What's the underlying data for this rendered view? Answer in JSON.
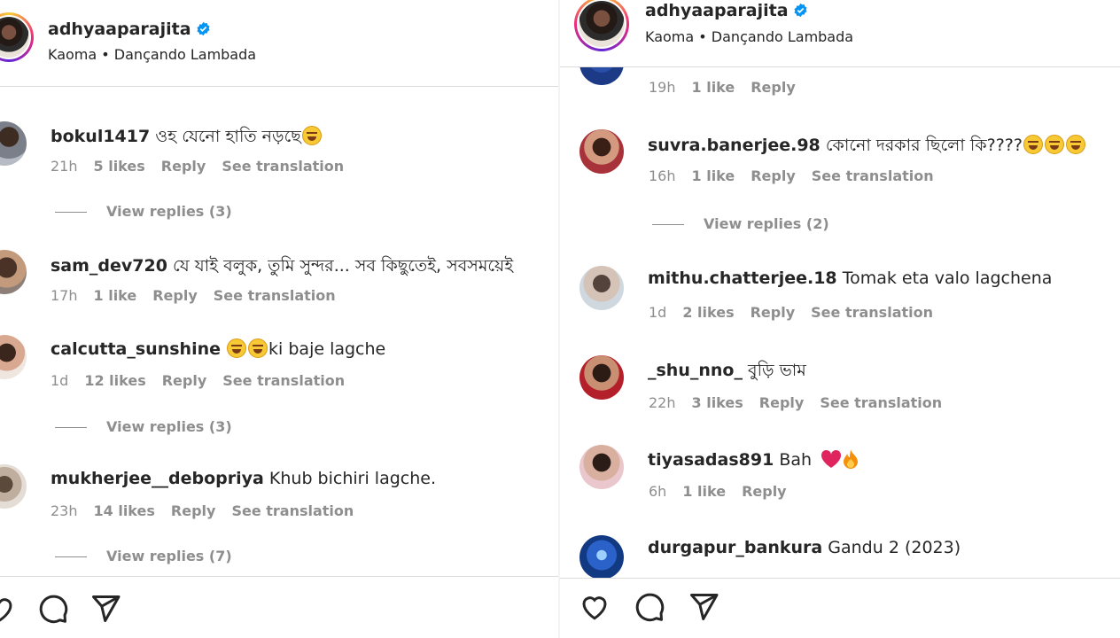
{
  "left": {
    "header": {
      "username": "adhyaaparajita",
      "subtitle": "Kaoma • Dançando Lambada"
    },
    "comments": [
      {
        "username": "bokul1417",
        "text": "ওহ যেনো হাতি নড়ছে",
        "emoji": "😂",
        "time": "21h",
        "likes": "5 likes",
        "reply": "Reply",
        "translate": "See translation",
        "replies": "View replies (3)"
      },
      {
        "username": "sam_dev720",
        "text": "যে যাই বলুক, তুমি সুন্দর... সব কিছুতেই, সবসময়েই",
        "time": "17h",
        "likes": "1 like",
        "reply": "Reply",
        "translate": "See translation"
      },
      {
        "username": "calcutta_sunshine",
        "emoji": "😂😂",
        "text": "ki baje lagche",
        "time": "1d",
        "likes": "12 likes",
        "reply": "Reply",
        "translate": "See translation",
        "replies": "View replies (3)"
      },
      {
        "username": "mukherjee__debopriya",
        "text": "Khub bichiri lagche.",
        "time": "23h",
        "likes": "14 likes",
        "reply": "Reply",
        "translate": "See translation",
        "replies": "View replies (7)"
      }
    ]
  },
  "right": {
    "header": {
      "username": "adhyaaparajita",
      "subtitle": "Kaoma • Dançando Lambada"
    },
    "top_meta": {
      "time": "19h",
      "likes": "1 like",
      "reply": "Reply"
    },
    "comments": [
      {
        "username": "suvra.banerjee.98",
        "text": "কোনো দরকার ছিলো কি????",
        "emoji": "😂😂😂",
        "time": "16h",
        "likes": "1 like",
        "reply": "Reply",
        "translate": "See translation",
        "replies": "View replies (2)"
      },
      {
        "username": "mithu.chatterjee.18",
        "text": "Tomak eta valo lagchena",
        "time": "1d",
        "likes": "2 likes",
        "reply": "Reply",
        "translate": "See translation"
      },
      {
        "username": "_shu_nno_",
        "text": "বুড়ি ভাম",
        "time": "22h",
        "likes": "3 likes",
        "reply": "Reply",
        "translate": "See translation"
      },
      {
        "username": "tiyasadas891",
        "text": "Bah",
        "emoji": "❤️🔥",
        "time": "6h",
        "likes": "1 like",
        "reply": "Reply"
      },
      {
        "username": "durgapur_bankura",
        "text": "Gandu 2 (2023)"
      }
    ]
  },
  "colors": {
    "text": "#262626",
    "muted": "#8e8e8e",
    "verified": "#0095f6",
    "heart": "#e0245e"
  }
}
